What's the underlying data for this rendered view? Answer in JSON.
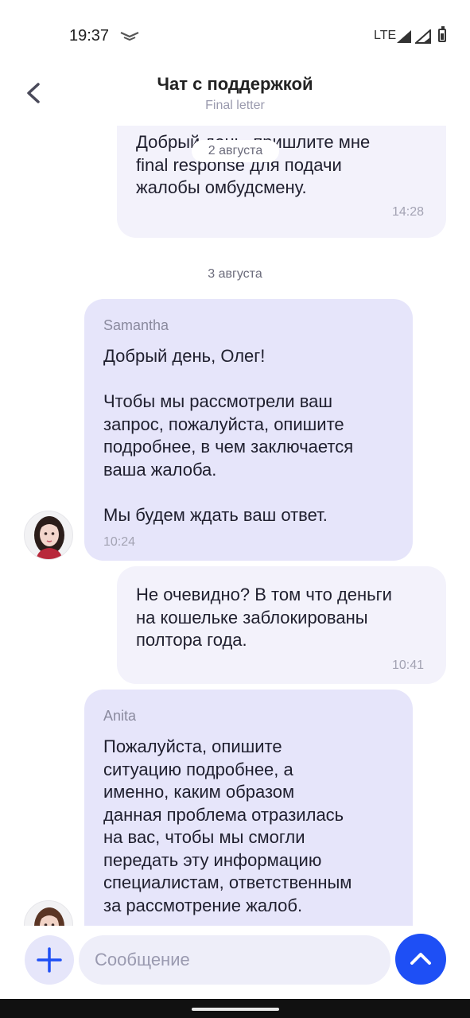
{
  "status_bar": {
    "time": "19:37",
    "network": "LTE",
    "icons": [
      "notification-icon",
      "signal-icon",
      "signal-icon",
      "battery-icon"
    ]
  },
  "header": {
    "title": "Чат с поддержкой",
    "subtitle": "Final letter",
    "back_icon": "chevron-left-icon"
  },
  "messages": [
    {
      "direction": "outgoing",
      "text": "Добрый день, пришлите мне\nfinal response для подачи\nжалобы омбудсмену.",
      "time": "14:28"
    },
    {
      "direction": "incoming",
      "sender": "Samantha",
      "text": "Добрый день, Олег!\n\nЧтобы мы рассмотрели ваш\nзапрос, пожалуйста, опишите\nподробнее, в чем заключается\nваша жалоба.\n\nМы будем ждать ваш ответ.",
      "time": "10:24"
    },
    {
      "direction": "outgoing",
      "text": "Не очевидно? В том что деньги\nна кошельке заблокированы\nполтора года.",
      "time": "10:41"
    },
    {
      "direction": "incoming",
      "sender": "Anita",
      "text": "Пожалуйста, опишите\nситуацию подробнее, а\nименно, каким образом\nданная проблема отразилась\nна вас, чтобы мы смогли\nпередать эту информацию\nспециалистам, ответственным\nза рассмотрение жалоб."
    }
  ],
  "date_labels": {
    "floating": "2 августа",
    "separator": "3 августа"
  },
  "composer": {
    "placeholder": "Сообщение",
    "attach_icon": "plus-icon",
    "scroll_icon": "chevron-up-icon"
  },
  "colors": {
    "accent": "#1e4ff5",
    "incoming_bubble": "#e6e5fa",
    "outgoing_bubble": "#f3f2fb"
  }
}
